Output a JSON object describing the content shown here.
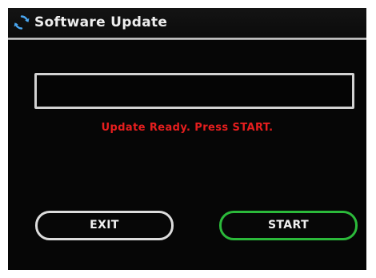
{
  "header": {
    "title": "Software Update",
    "icon": "refresh-icon"
  },
  "progress": {
    "value": 0
  },
  "status": {
    "message": "Update Ready. Press START.",
    "color": "#e61e1e"
  },
  "buttons": {
    "exit_label": "EXIT",
    "start_label": "START",
    "start_border_color": "#2bb93a",
    "exit_border_color": "#dcdcdc"
  }
}
